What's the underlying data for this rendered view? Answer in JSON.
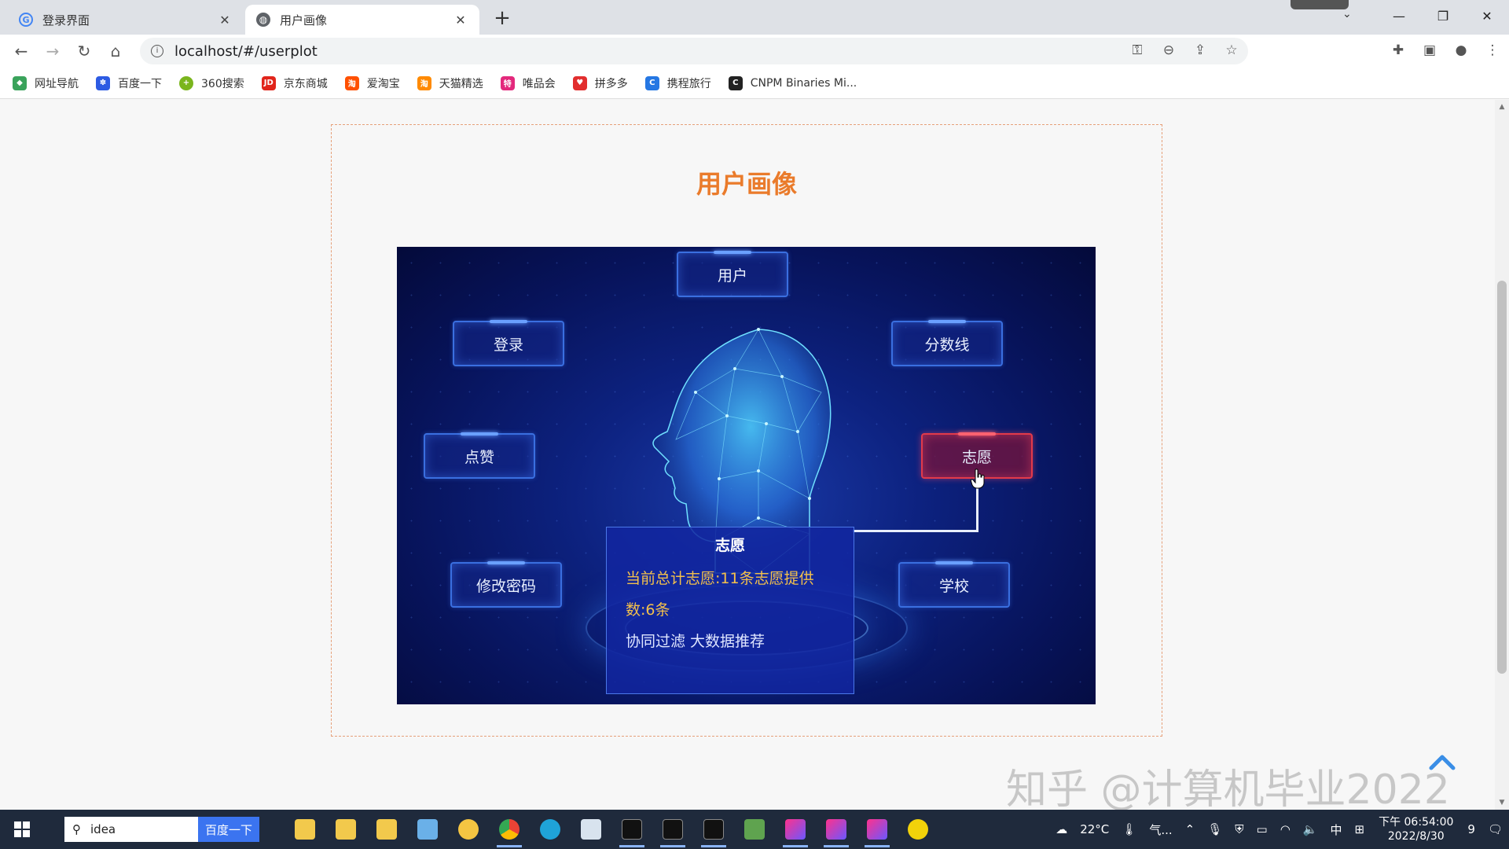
{
  "browser": {
    "tabs": [
      {
        "title": "登录界面",
        "favicon": "google-g-icon"
      },
      {
        "title": "用户画像",
        "favicon": "globe-icon"
      }
    ],
    "url": "localhost/#/userplot",
    "bookmarks": [
      {
        "label": "网址导航",
        "color": "#3aa35b"
      },
      {
        "label": "百度一下",
        "color": "#2d5be3"
      },
      {
        "label": "360搜索",
        "color": "#7ab51d"
      },
      {
        "label": "京东商城",
        "color": "#e1251b"
      },
      {
        "label": "爱淘宝",
        "color": "#ff5000"
      },
      {
        "label": "天猫精选",
        "color": "#ff8a00"
      },
      {
        "label": "唯品会",
        "color": "#e3297c"
      },
      {
        "label": "拼多多",
        "color": "#e22e2e"
      },
      {
        "label": "携程旅行",
        "color": "#2577e3"
      },
      {
        "label": "CNPM Binaries Mi...",
        "color": "#222222"
      }
    ]
  },
  "page": {
    "title": "用户画像",
    "nodes": [
      {
        "id": "user",
        "label": "用户"
      },
      {
        "id": "login",
        "label": "登录"
      },
      {
        "id": "score",
        "label": "分数线"
      },
      {
        "id": "like",
        "label": "点赞"
      },
      {
        "id": "wish",
        "label": "志愿"
      },
      {
        "id": "password",
        "label": "修改密码"
      },
      {
        "id": "school",
        "label": "学校"
      }
    ],
    "tooltip": {
      "title": "志愿",
      "line1": "当前总计志愿:11条志愿提供",
      "line2": "数:6条",
      "line3": "协同过滤 大数据推荐"
    },
    "watermark": "知乎 @计算机毕业2022"
  },
  "taskbar": {
    "search_value": "idea",
    "search_button": "百度一下",
    "weather": "22°C",
    "weather_extra": "气...",
    "ime": "中",
    "time": "下午 06:54:00",
    "date": "2022/8/30",
    "notifications": "9"
  },
  "colors": {
    "title_orange": "#ea7b2b",
    "tooltip_highlight": "#f3c04c",
    "active_node": "#e23a4a"
  }
}
